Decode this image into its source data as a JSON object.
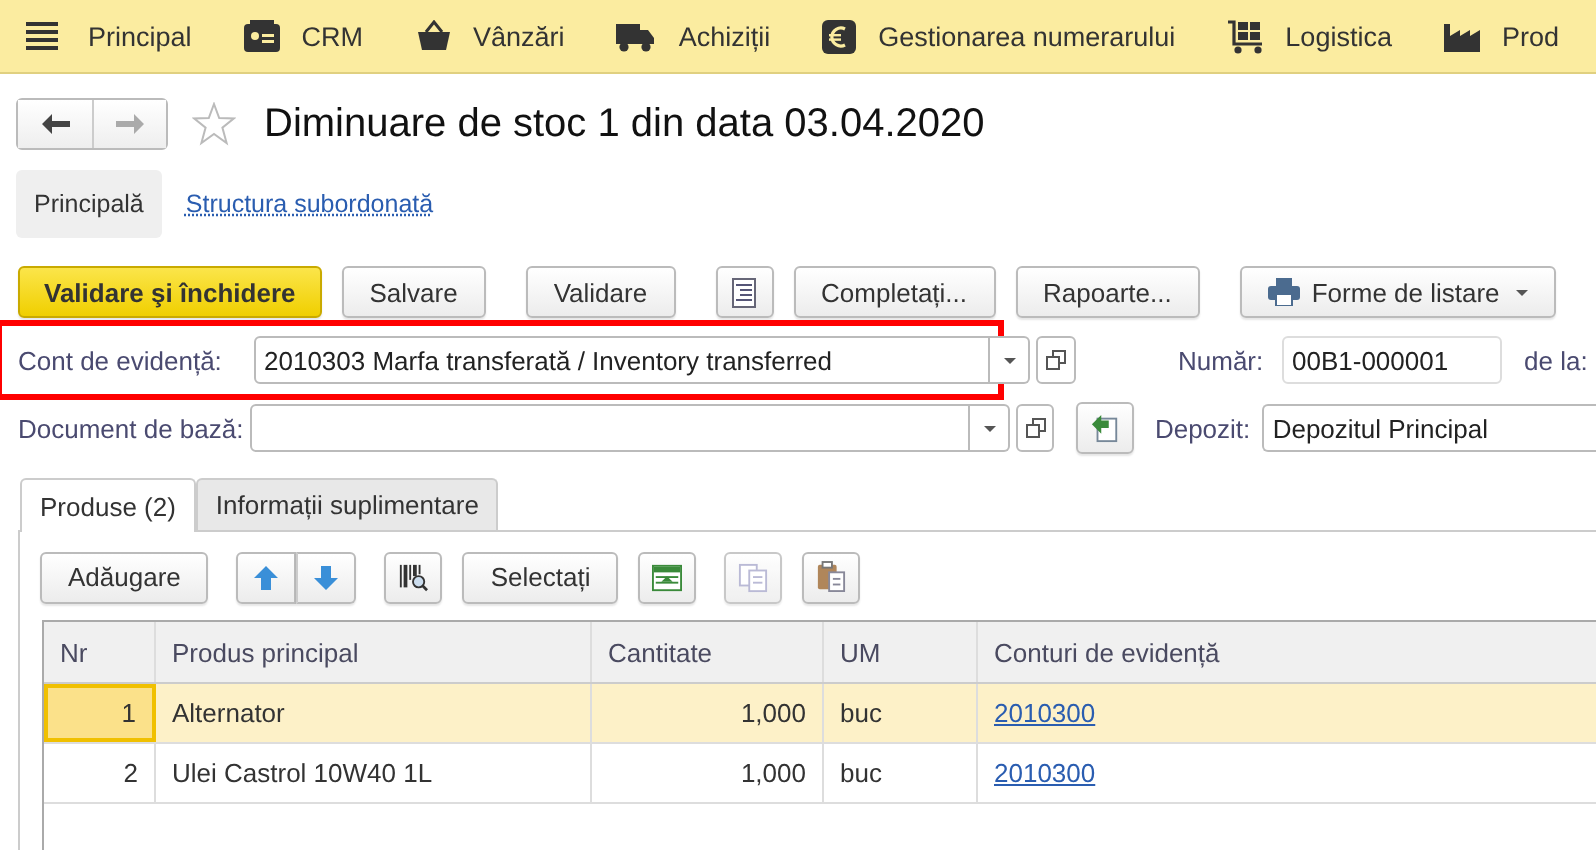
{
  "menu": [
    {
      "kind": "menu",
      "label": "Principal"
    },
    {
      "kind": "card",
      "label": "CRM"
    },
    {
      "kind": "basket",
      "label": "Vânzări"
    },
    {
      "kind": "truck",
      "label": "Achiziții"
    },
    {
      "kind": "euro",
      "label": "Gestionarea numerarului"
    },
    {
      "kind": "cart",
      "label": "Logistica"
    },
    {
      "kind": "factory",
      "label": "Prod"
    }
  ],
  "header": {
    "title": "Diminuare de stoc 1 din data 03.04.2020",
    "favorite": false
  },
  "sections": [
    {
      "label": "Principală",
      "selected": true
    },
    {
      "label": "Structura subordonată",
      "selected": false
    }
  ],
  "commands": [
    {
      "kind": "primary",
      "label": "Validare şi închidere"
    },
    {
      "kind": "button",
      "label": "Salvare"
    },
    {
      "kind": "button",
      "label": "Validare"
    },
    {
      "kind": "doc"
    },
    {
      "kind": "button",
      "label": "Completați..."
    },
    {
      "kind": "button",
      "label": "Rapoarte..."
    },
    {
      "kind": "print",
      "label": "Forme de listare"
    }
  ],
  "account": {
    "label": "Cont de evidență:",
    "value": "2010303 Marfa transferată / Inventory transferred",
    "highlighted": true
  },
  "number": {
    "label": "Număr:",
    "value": "00B1-000001"
  },
  "date": {
    "label": "de la:"
  },
  "base_document": {
    "label": "Document de bază:"
  },
  "warehouse": {
    "label": "Depozit:",
    "value": "Depozitul Principal"
  },
  "tabs": [
    {
      "label": "Produse (2)",
      "selected": true
    },
    {
      "label": "Informații suplimentare",
      "selected": false
    }
  ],
  "toolbar": [
    {
      "kind": "text",
      "label": "Adăugare"
    },
    {
      "kind": "updown"
    },
    {
      "kind": "barcode"
    },
    {
      "kind": "text",
      "label": "Selectați"
    },
    {
      "kind": "fill"
    },
    {
      "kind": "copy"
    },
    {
      "kind": "paste"
    }
  ],
  "table": {
    "columns": [
      "Nr",
      "Produs principal",
      "Cantitate",
      "UM",
      "Conturi de evidență"
    ],
    "rows": [
      {
        "nr": "1",
        "product": "Alternator",
        "quantity": "1,000",
        "unit": "buc",
        "account": "2010300",
        "selected": true
      },
      {
        "nr": "2",
        "product": "Ulei Castrol 10W40 1L",
        "quantity": "1,000",
        "unit": "buc",
        "account": "2010300",
        "selected": false
      }
    ]
  }
}
